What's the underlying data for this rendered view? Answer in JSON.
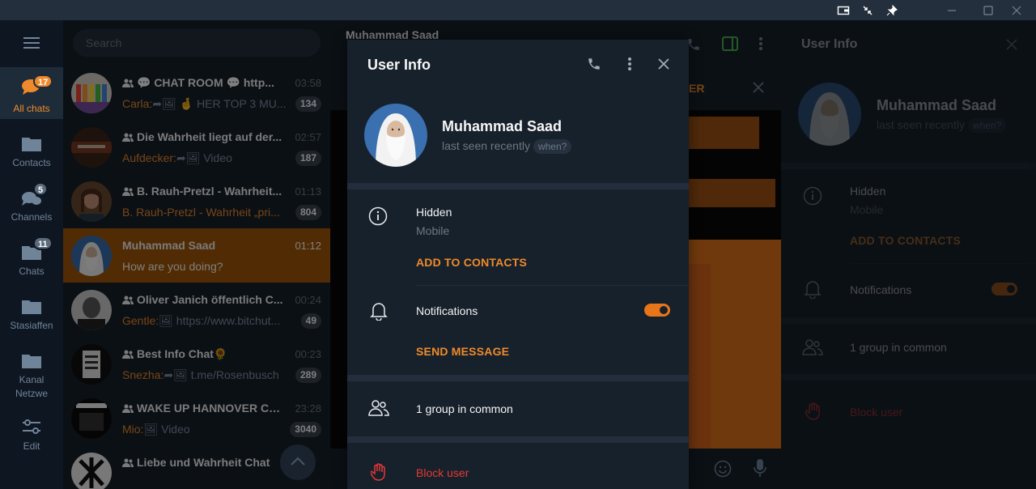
{
  "search": {
    "placeholder": "Search"
  },
  "folders": [
    {
      "label": "All chats",
      "icon": "chat-bubbles-icon",
      "badge": "17",
      "active": true
    },
    {
      "label": "Contacts",
      "icon": "folder-icon",
      "badge": ""
    },
    {
      "label": "Channels",
      "icon": "chat-bubbles-icon",
      "badge": "5"
    },
    {
      "label": "Chats",
      "icon": "folder-icon",
      "badge": "11"
    },
    {
      "label": "Stasiaffen",
      "icon": "folder-icon",
      "badge": ""
    },
    {
      "label": "Kanal Netzwe",
      "icon": "folder-icon",
      "badge": ""
    },
    {
      "label": "Edit",
      "icon": "sliders-icon",
      "badge": ""
    }
  ],
  "chats": [
    {
      "name": "💬 CHAT ROOM 💬 http...",
      "time": "03:58",
      "sender": "Carla:",
      "preview": "➦🖼 🤞 HER TOP 3 MU...",
      "unread": "134",
      "group": true
    },
    {
      "name": "Die Wahrheit liegt auf der...",
      "time": "02:57",
      "sender": "Aufdecker:",
      "preview": "➦🖼 Video",
      "unread": "187",
      "group": true
    },
    {
      "name": "B. Rauh-Pretzl - Wahrheit...",
      "time": "01:13",
      "sender": "B. Rauh-Pretzl - Wahrheit „pri...",
      "preview": "",
      "unread": "804",
      "group": true
    },
    {
      "name": "Muhammad Saad",
      "time": "01:12",
      "sender": "",
      "preview": "How are you doing?",
      "unread": "",
      "group": false,
      "selected": true
    },
    {
      "name": "Oliver Janich öffentlich C...",
      "time": "00:24",
      "sender": "Gentle:",
      "preview": "🖼 https://www.bitchut...",
      "unread": "49",
      "group": true
    },
    {
      "name": "Best Info Chat🌻",
      "time": "00:23",
      "sender": "Snezha:",
      "preview": "➦🖼 t.me/Rosenbusch",
      "unread": "289",
      "group": true
    },
    {
      "name": "WAKE UP HANNOVER CH...",
      "time": "23:28",
      "sender": "Mio:",
      "preview": "🖼 Video",
      "unread": "3040",
      "group": true
    },
    {
      "name": "Liebe und Wahrheit Chat",
      "time": "",
      "sender": "",
      "preview": "",
      "unread": "",
      "group": true
    }
  ],
  "chat_header": {
    "title": "Muhammad Saad"
  },
  "pinned_fragment": "ER",
  "modal": {
    "title": "User Info",
    "name": "Muhammad Saad",
    "status": "last seen recently",
    "when": "when?",
    "phone_title": "Hidden",
    "phone_sub": "Mobile",
    "add_contacts": "ADD TO CONTACTS",
    "notifications": "Notifications",
    "notifications_on": true,
    "send_message": "SEND MESSAGE",
    "groups_common": "1 group in common",
    "block": "Block user"
  },
  "right_panel": {
    "title": "User Info",
    "name": "Muhammad Saad",
    "status": "last seen recently",
    "when": "when?",
    "phone_title": "Hidden",
    "phone_sub": "Mobile",
    "add_contacts": "ADD TO CONTACTS",
    "notifications": "Notifications",
    "groups_common": "1 group in common",
    "block": "Block user"
  },
  "colors": {
    "accent": "#ef8a2b",
    "toggle": "#e8751a",
    "danger": "#e53935",
    "bg": "#17212b",
    "sidebar": "#0e1621",
    "selected": "#a35608"
  }
}
